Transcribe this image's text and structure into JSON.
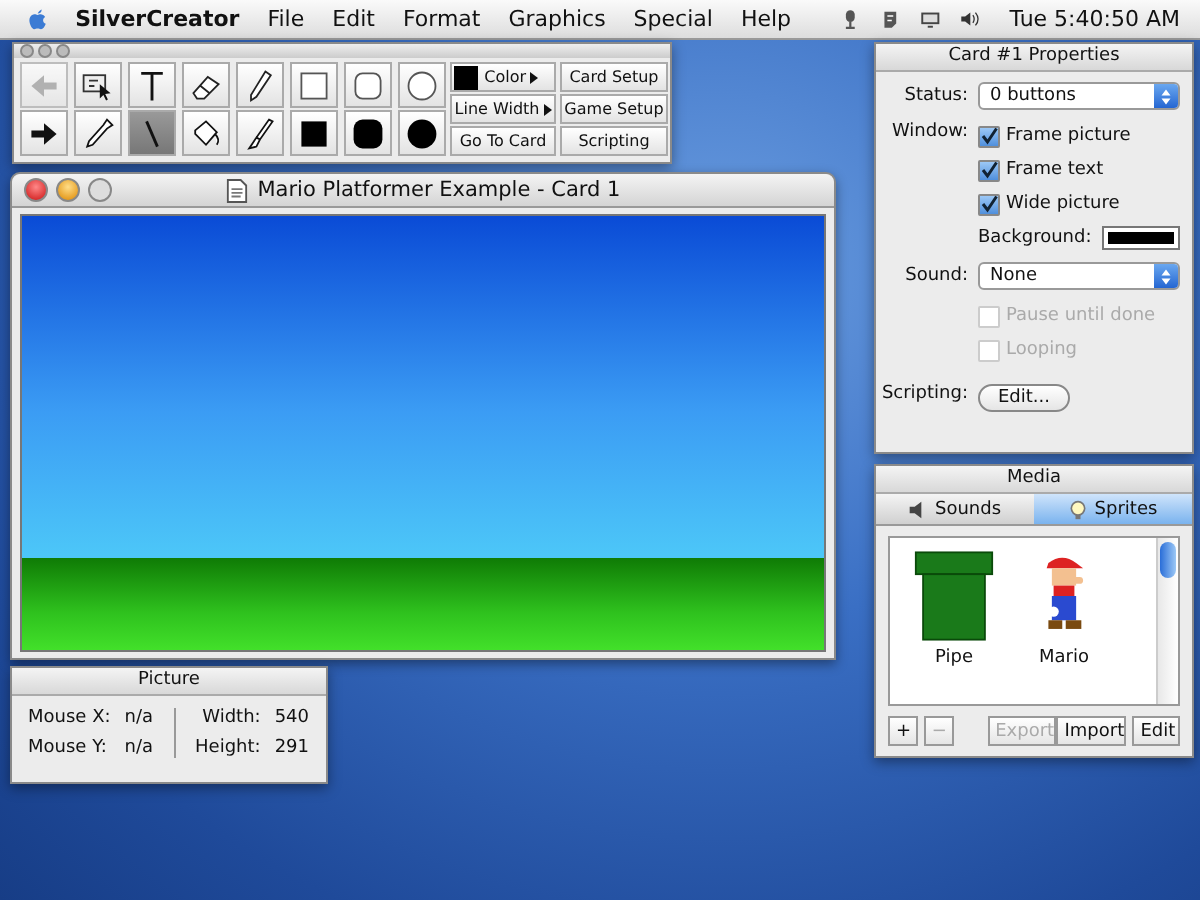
{
  "menubar": {
    "app": "SilverCreator",
    "menus": [
      "File",
      "Edit",
      "Format",
      "Graphics",
      "Special",
      "Help"
    ],
    "clock": "Tue 5:40:50 AM"
  },
  "tools": {
    "items": [
      {
        "kind": "back",
        "selected": false,
        "disabled": true
      },
      {
        "kind": "select",
        "selected": false,
        "disabled": false
      },
      {
        "kind": "text",
        "selected": false,
        "disabled": false
      },
      {
        "kind": "eraser",
        "selected": false,
        "disabled": false
      },
      {
        "kind": "pencil",
        "selected": false,
        "disabled": false
      },
      {
        "kind": "rect",
        "selected": false,
        "disabled": false
      },
      {
        "kind": "roundrect",
        "selected": false,
        "disabled": false
      },
      {
        "kind": "oval",
        "selected": false,
        "disabled": false
      },
      {
        "kind": "forward",
        "selected": false,
        "disabled": false
      },
      {
        "kind": "dropper",
        "selected": false,
        "disabled": false
      },
      {
        "kind": "line",
        "selected": true,
        "disabled": false
      },
      {
        "kind": "bucket",
        "selected": false,
        "disabled": false
      },
      {
        "kind": "brush",
        "selected": false,
        "disabled": false
      },
      {
        "kind": "fillrect",
        "selected": false,
        "disabled": false
      },
      {
        "kind": "fillroundrect",
        "selected": false,
        "disabled": false
      },
      {
        "kind": "filloval",
        "selected": false,
        "disabled": false
      }
    ],
    "color": {
      "label": "Color",
      "color": "#000000"
    },
    "line_width": "Line Width",
    "go_to_card": "Go To Card",
    "buttons": [
      "Card Setup",
      "Game Setup",
      "Scripting"
    ]
  },
  "card_window": {
    "title": "Mario Platformer Example - Card 1"
  },
  "picture": {
    "title": "Picture",
    "left": [
      {
        "label": "Mouse X:",
        "value": "n/a"
      },
      {
        "label": "Mouse Y:",
        "value": "n/a"
      }
    ],
    "right": [
      {
        "label": "Width:",
        "value": "540"
      },
      {
        "label": "Height:",
        "value": "291"
      }
    ]
  },
  "properties": {
    "title": "Card #1 Properties",
    "status": {
      "label": "Status:",
      "value": "0 buttons"
    },
    "window_label": "Window:",
    "window_options": [
      {
        "label": "Frame picture",
        "checked": true,
        "disabled": false
      },
      {
        "label": "Frame text",
        "checked": true,
        "disabled": false
      },
      {
        "label": "Wide picture",
        "checked": true,
        "disabled": false
      }
    ],
    "background": {
      "label": "Background:",
      "color": "#000000"
    },
    "sound": {
      "label": "Sound:",
      "value": "None"
    },
    "sound_options": [
      {
        "label": "Pause until done",
        "checked": false,
        "disabled": true
      },
      {
        "label": "Looping",
        "checked": false,
        "disabled": true
      }
    ],
    "scripting": {
      "label": "Scripting:",
      "button": "Edit..."
    }
  },
  "media": {
    "title": "Media",
    "tabs": [
      {
        "label": "Sounds",
        "selected": false,
        "kind": "speaker"
      },
      {
        "label": "Sprites",
        "selected": true,
        "kind": "bulb"
      }
    ],
    "sprites": [
      {
        "name": "Pipe",
        "kind": "pipe"
      },
      {
        "name": "Mario",
        "kind": "character"
      }
    ],
    "buttons": [
      {
        "label": "+",
        "disabled": false
      },
      {
        "label": "−",
        "disabled": true
      },
      {
        "label": "Export",
        "disabled": true
      },
      {
        "label": "Import",
        "disabled": false
      },
      {
        "label": "Edit",
        "disabled": false
      }
    ]
  }
}
